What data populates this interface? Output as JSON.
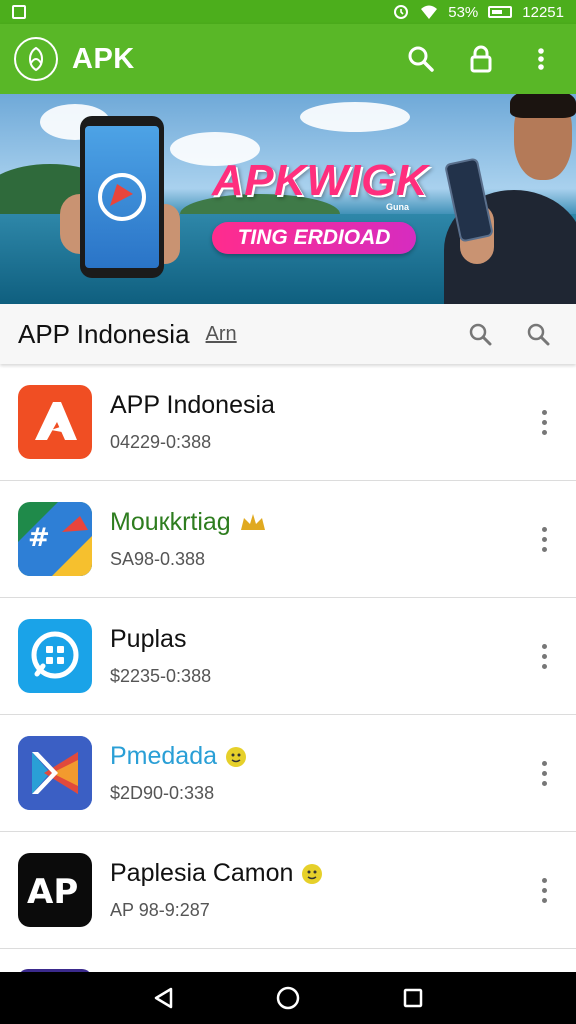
{
  "status_bar": {
    "battery": "53%",
    "time": "12251"
  },
  "app_bar": {
    "title": "APK"
  },
  "banner": {
    "headline": "APKWIGK",
    "small_text": "Guna",
    "cta": "TING ERDIOAD"
  },
  "search_row": {
    "title": "APP Indonesia",
    "sub_link": "Arn"
  },
  "apps": [
    {
      "name": "APP Indonesia",
      "subtitle": "04229-0:388",
      "name_color": "#111111",
      "icon_bg": "#f04e23",
      "icon_name": "apkpure-a-icon",
      "badge": ""
    },
    {
      "name": "Mouкkrtiag",
      "subtitle": "SA98-0.388",
      "name_color": "#2e7d1f",
      "icon_bg": "#1f8a4a",
      "icon_name": "maps-hash-icon",
      "badge": "crown"
    },
    {
      "name": "Puplas",
      "subtitle": "$2235-0:388",
      "name_color": "#111111",
      "icon_bg": "#1aa3e8",
      "icon_name": "chat-bubble-icon",
      "badge": ""
    },
    {
      "name": "Pmedada",
      "subtitle": "$2D90-0:338",
      "name_color": "#2a9fd6",
      "icon_bg": "#2f5fd0",
      "icon_name": "k-logo-icon",
      "badge": "emoji"
    },
    {
      "name": "Paplesia Camon",
      "subtitle": "AP 98-9:287",
      "name_color": "#111111",
      "icon_bg": "#0b0b0b",
      "icon_name": "ap-logo-icon",
      "badge": "emoji"
    }
  ],
  "colors": {
    "app_bar": "#59b727",
    "status_bar": "#4cae1c",
    "cta_pink": "#ff2c8d"
  }
}
